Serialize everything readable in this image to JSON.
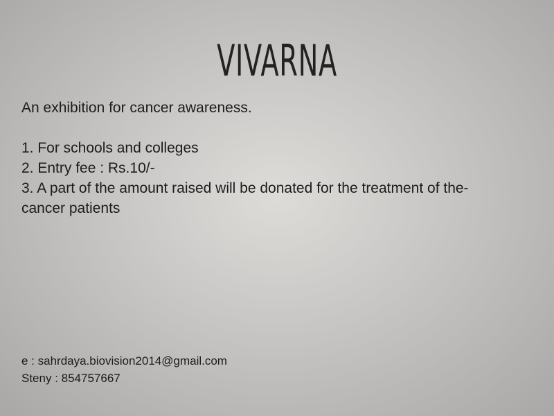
{
  "slide": {
    "title": "VIVARNA",
    "intro": "An exhibition for cancer awareness.",
    "points": [
      "1. For schools and colleges",
      "2. Entry fee : Rs.10/-",
      "3. A part of the amount raised will be donated for the treatment of the-",
      "cancer patients"
    ],
    "contact": {
      "email_line": "e : sahrdaya.biovision2014@gmail.com",
      "phone_line": "Steny : 854757667"
    }
  }
}
